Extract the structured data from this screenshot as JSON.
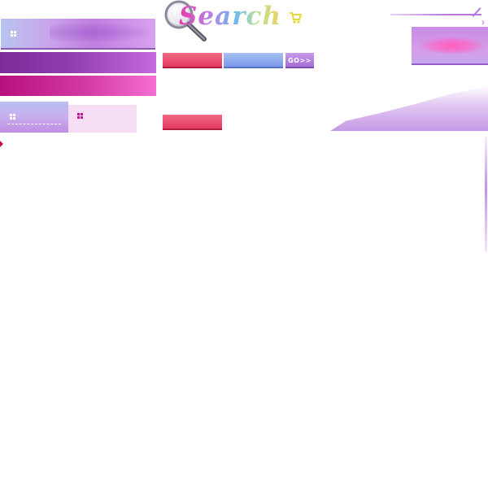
{
  "header": {
    "logo_text": "Search"
  },
  "toolbar": {
    "go_label": "GO>>",
    "red_button_1_label": "",
    "blue_button_label": "",
    "red_button_2_label": ""
  },
  "icons": {
    "cart": "shopping-cart-icon",
    "grid": "grid-icon",
    "magnifier": "magnifier-icon",
    "chevron": "chevron-right-icon"
  },
  "colors": {
    "accent_purple": "#b878de",
    "accent_magenta": "#d23aa6",
    "button_red": "#e43a62",
    "button_blue": "#7a98e8",
    "cart_yellow": "#e6d83a"
  }
}
